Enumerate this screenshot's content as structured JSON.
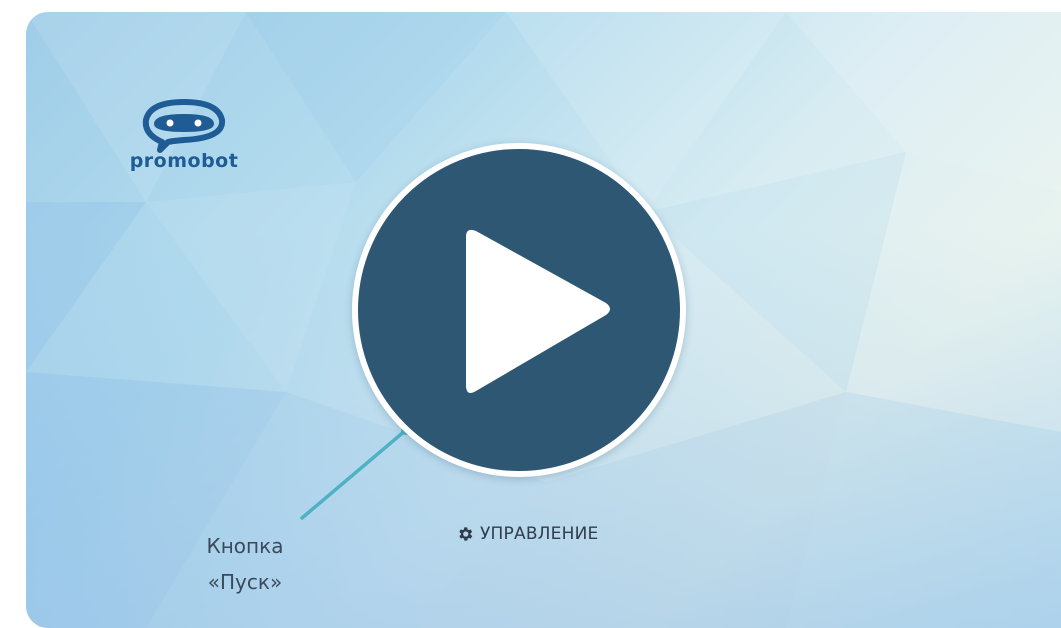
{
  "logo": {
    "text": "promobot",
    "color": "#1f5c95"
  },
  "play_button": {
    "icon": "play-icon",
    "fill": "#2e5774"
  },
  "callout": {
    "line1": "Кнопка",
    "line2": "«Пуск»",
    "line_color": "#4fb1c4"
  },
  "control": {
    "icon": "gear-icon",
    "label": "УПРАВЛЕНИЕ"
  }
}
